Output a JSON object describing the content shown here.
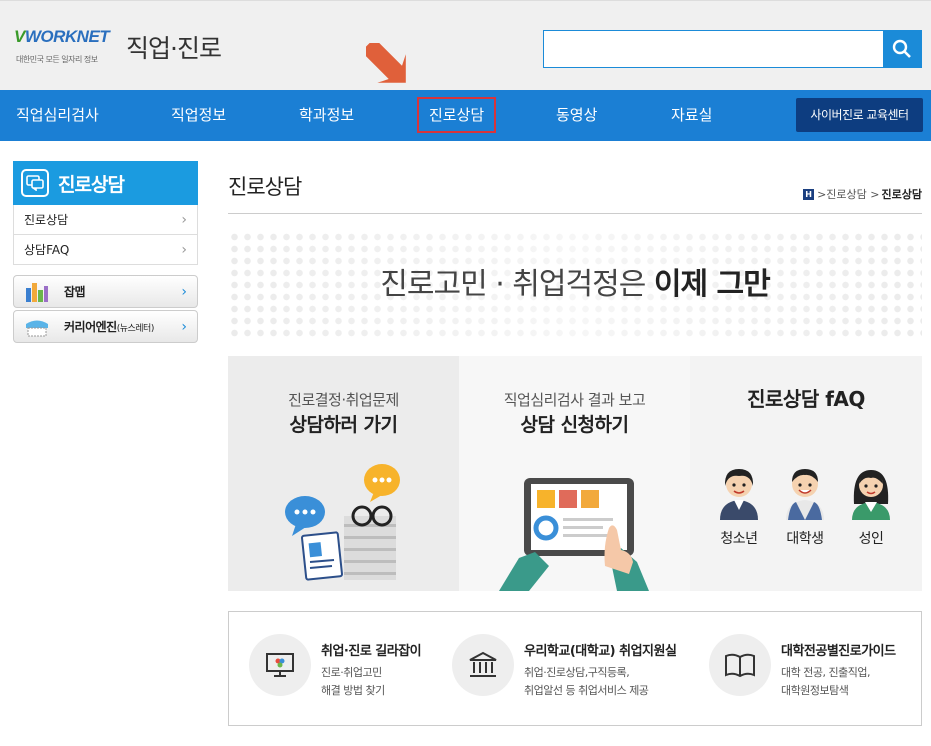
{
  "header": {
    "logo_text": "WORKNET",
    "logo_sub": "대한민국 모든 일자리 정보",
    "site_title": "직업·진로",
    "search_placeholder": ""
  },
  "nav": {
    "items": [
      "직업심리검사",
      "직업정보",
      "학과정보",
      "진로상담",
      "동영상",
      "자료실"
    ],
    "active_index": 3,
    "cyber_button": "사이버진로 교육센터"
  },
  "sidebar": {
    "title": "진로상담",
    "links": [
      "진로상담",
      "상담FAQ"
    ],
    "cards": [
      {
        "label": "잡맵",
        "small": ""
      },
      {
        "label": "커리어엔진",
        "small": "(뉴스레터)"
      }
    ]
  },
  "main": {
    "page_title": "진로상담",
    "breadcrumb": {
      "home": "H",
      "mid": ">진로상담 >",
      "current": "진로상담"
    },
    "hero": {
      "text_normal": "진로고민 · 취업걱정은 ",
      "text_bold": "이제 그만"
    },
    "panels": [
      {
        "line1": "진로결정·취업문제",
        "line2": "상담하러 가기"
      },
      {
        "line1": "직업심리검사 결과 보고",
        "line2": "상담 신청하기"
      },
      {
        "line1": "",
        "line2": "진로상담 fAQ"
      }
    ],
    "personas": [
      "청소년",
      "대학생",
      "성인"
    ],
    "services": [
      {
        "title": "취업·진로 길라잡이",
        "desc": "진로·취업고민\n해결 방법 찾기"
      },
      {
        "title": "우리학교(대학교) 취업지원실",
        "desc": "취업·진로상담,구직등록,\n취업알선 등 취업서비스 제공"
      },
      {
        "title": "대학전공별진로가이드",
        "desc": "대학 전공, 진출직업,\n대학원정보탐색"
      }
    ]
  },
  "colors": {
    "accent": "#1b7fd4",
    "highlight": "#d9343b",
    "dark_button": "#0d3d80",
    "arrow": "#e0603a"
  }
}
